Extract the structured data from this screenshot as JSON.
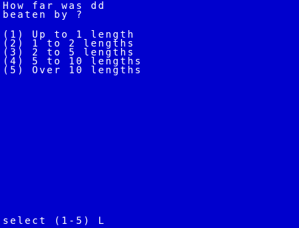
{
  "screen": {
    "question_line1": "How far was dd",
    "question_line2": "beaten by ?",
    "options": [
      "(1) Up to 1 length",
      "(2) 1 to 2 lengths",
      "(3) 2 to 5 lengths",
      "(4) 5 to 10 lengths",
      "(5) Over 10 lengths"
    ],
    "prompt": "select (1-5)",
    "cursor": "L"
  },
  "colors": {
    "background": "#0000cd",
    "text": "#ffffff"
  }
}
